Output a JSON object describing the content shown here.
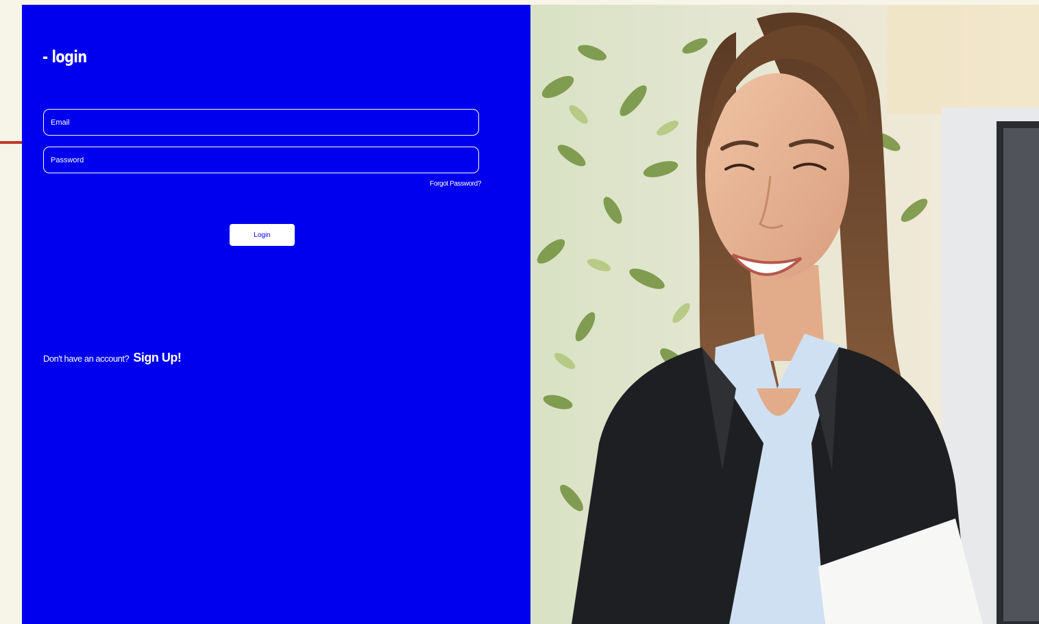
{
  "login": {
    "title": "- login",
    "email_placeholder": "Email",
    "password_placeholder": "Password",
    "forgot_password": "Forgot Password?",
    "login_button": "Login",
    "signup_prompt": "Don't have an account?",
    "signup_link": "Sign Up!"
  },
  "colors": {
    "panel": "#0000ee",
    "page_background": "#f7f4e8",
    "text": "#ffffff",
    "annotation_arrow": "#c0392b"
  },
  "photo": {
    "icon": "smiling-businesswoman-photo"
  }
}
